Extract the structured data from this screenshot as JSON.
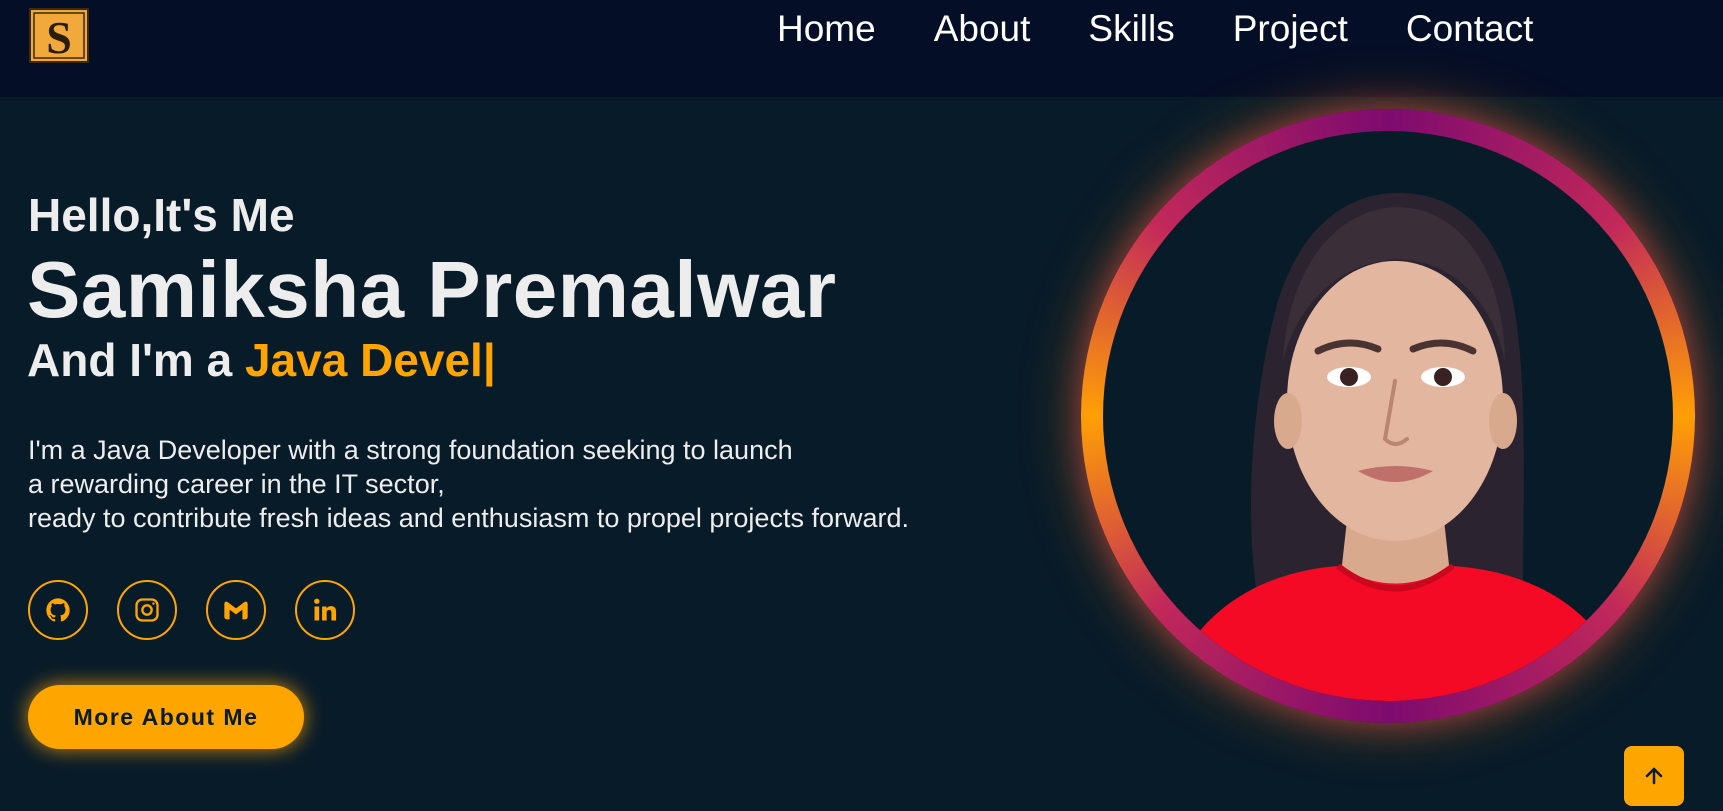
{
  "nav": {
    "items": [
      {
        "label": "Home"
      },
      {
        "label": "About"
      },
      {
        "label": "Skills"
      },
      {
        "label": "Project"
      },
      {
        "label": "Contact"
      }
    ]
  },
  "hero": {
    "greeting": "Hello,It's Me",
    "name": "Samiksha Premalwar",
    "role_prefix": "And I'm a ",
    "role_typed": "Java Devel",
    "role_caret": "|",
    "intro_lines": [
      "I'm a Java Developer with a strong foundation seeking to launch",
      "a rewarding career in the IT sector,",
      "ready to contribute fresh ideas and enthusiasm to propel projects forward."
    ],
    "socials": [
      {
        "icon": "github-icon"
      },
      {
        "icon": "instagram-icon"
      },
      {
        "icon": "gmail-icon"
      },
      {
        "icon": "linkedin-icon"
      }
    ],
    "cta_label": "More About Me"
  },
  "colors": {
    "background": "#081b29",
    "navbar": "#040e26",
    "accent": "#ffa500",
    "text": "#ededed"
  }
}
